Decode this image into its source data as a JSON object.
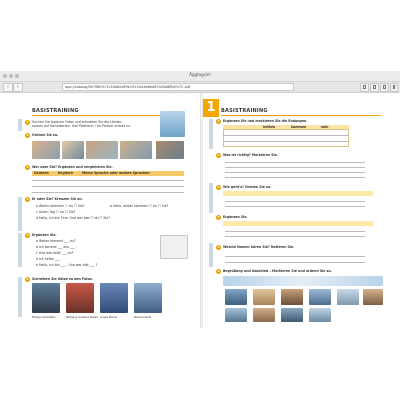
{
  "window": {
    "title": "Äggtagsim"
  },
  "toolbar": {
    "back_label": "‹",
    "forward_label": "›",
    "url": "app://catalog/007080%7Cr4d4b0e89e1911facbe8ed870d5a8f8d/%7C.pdf"
  },
  "left_page": {
    "section_title": "BASISTRAINING",
    "ex1_text_a": "Suchen Sie typische Fotos und schreiben Sie die Länder-",
    "ex1_text_b": "namen auf Karteikarten. Ihre Partnerin / Ihr Partner ordnet zu.",
    "ex2_title": "Ordnen Sie zu.",
    "ex3_title": "Wer oder Sie? Ergänzen und vergleichen Sie.",
    "table_headers": [
      "Deutsch",
      "Englisch",
      "Meine Sprache oder andere Sprachen"
    ],
    "ex4_title": "Er oder Sie? Kreuzen Sie an.",
    "ex4_rows": [
      "a   Woher kommen    ☐ du  ☐ Sie?",
      "b   Hallo, woher kommen ☐ du  ☐ Sie?",
      "c   Guten Tag ☐ du  ☐ Sie?",
      "d   Hallo, ich bin Tina. Und wer bist ☐ du ☐ Sie?"
    ],
    "ex5_title": "Ergänzen Sie.",
    "ex5_rows": [
      "a   Woher kommst ___ du?",
      "b   Ich komme ___ aus ___ .",
      "c   Und wie heißt ___ du?",
      "d   Ich heiße ___ .",
      "e   Hallo, ich bin ___ . Und wer bist ___ ?"
    ],
    "ex6_title": "Schreiben Sie Sätze zu den Fotos.",
    "photo_captions": [
      "Philippa Sartzetakis",
      "Wolfgang Amadeus Mozart",
      "Angela Merkel",
      "Markus Kreutz"
    ]
  },
  "right_page": {
    "section_title": "BASISTRAINING",
    "chapter_number": "1",
    "ex1_title": "Ergänzen Sie und markieren Sie die Endungen.",
    "ex1_headers": [
      "",
      "heißen",
      "kommen",
      "sein"
    ],
    "ex2_title": "Was ist richtig? Markieren Sie.",
    "ex3_title": "Wie geht's? Ordnen Sie zu.",
    "ex4_title": "Ergänzen Sie.",
    "ex5_title": "Welche Namen hören Sie? Notieren Sie.",
    "ex6_title": "Begrüßung und Abschied – Markieren Sie und ordnen Sie zu."
  }
}
